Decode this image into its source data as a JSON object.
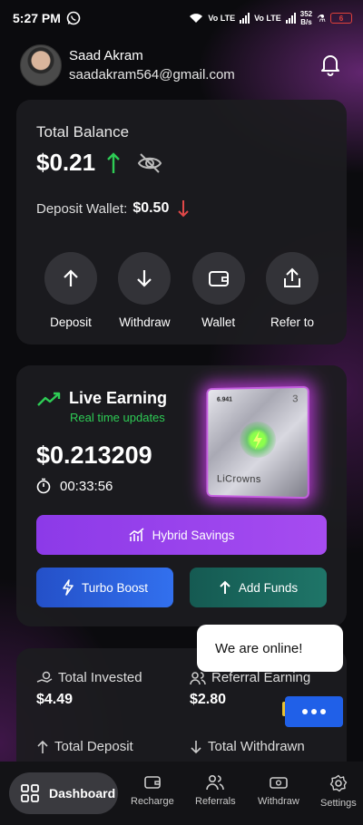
{
  "status_bar": {
    "time": "5:27 PM",
    "net1": "Vo LTE",
    "net2": "Vo LTE",
    "speed_value": "352",
    "speed_unit": "B/s",
    "battery": "6"
  },
  "user": {
    "name": "Saad Akram",
    "email": "saadakram564@gmail.com"
  },
  "balance": {
    "label": "Total Balance",
    "value": "$0.21",
    "deposit_label": "Deposit Wallet:",
    "deposit_value": "$0.50"
  },
  "actions": [
    {
      "label": "Deposit",
      "icon": "arrow-up-icon"
    },
    {
      "label": "Withdraw",
      "icon": "arrow-down-icon"
    },
    {
      "label": "Wallet",
      "icon": "wallet-icon"
    },
    {
      "label": "Refer to",
      "icon": "share-icon"
    }
  ],
  "live": {
    "title": "Live Earning",
    "subtitle": "Real time updates",
    "amount": "$0.213209",
    "timer": "00:33:56",
    "nft_value": "6.941",
    "nft_brand": "LiCrowns",
    "nft_number": "3"
  },
  "buttons": {
    "hybrid": "Hybrid Savings",
    "turbo": "Turbo Boost",
    "add_funds": "Add Funds"
  },
  "stats": {
    "invested_label": "Total Invested",
    "invested_value": "$4.49",
    "referral_label": "Referral Earning",
    "referral_value": "$2.80",
    "deposit_label": "Total Deposit",
    "withdrawn_label": "Total Withdrawn"
  },
  "chat": {
    "message": "We are online!"
  },
  "nav": {
    "dashboard": "Dashboard",
    "recharge": "Recharge",
    "referrals": "Referrals",
    "withdraw": "Withdraw",
    "settings": "Settings"
  },
  "colors": {
    "accent_purple": "#9b3cf0",
    "turbo_blue": "#2a5de0",
    "add_funds_teal": "#1a6a60",
    "up_green": "#2ecc55",
    "down_red": "#e04848"
  }
}
